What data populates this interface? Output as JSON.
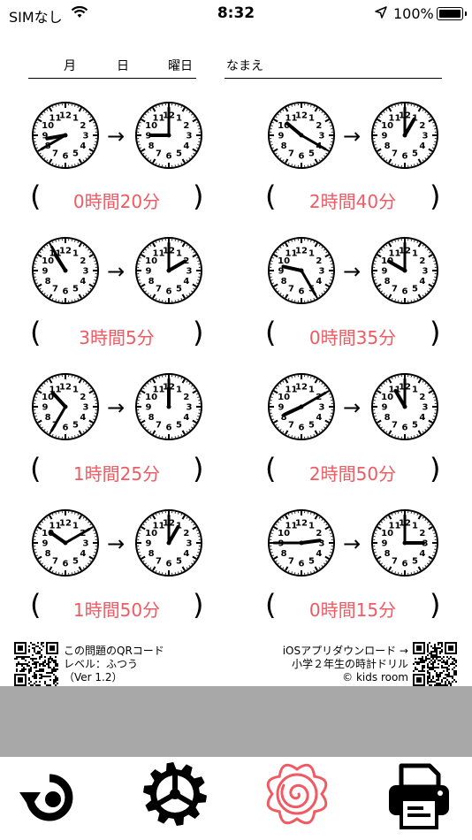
{
  "status_bar": {
    "carrier": "SIMなし",
    "time": "8:32",
    "battery": "100%",
    "battery_level": 1.0
  },
  "worksheet": {
    "date_labels": [
      "月",
      "日",
      "曜日"
    ],
    "name_label": "なまえ",
    "problems": [
      {
        "answer": "0時間20分",
        "start": {
          "hour": 8,
          "minute": 40
        },
        "end": {
          "hour": 9,
          "minute": 0
        }
      },
      {
        "answer": "2時間40分",
        "start": {
          "hour": 10,
          "minute": 20
        },
        "end": {
          "hour": 1,
          "minute": 0
        }
      },
      {
        "answer": "3時間5分",
        "start": {
          "hour": 10,
          "minute": 55
        },
        "end": {
          "hour": 2,
          "minute": 0
        }
      },
      {
        "answer": "0時間35分",
        "start": {
          "hour": 9,
          "minute": 25
        },
        "end": {
          "hour": 10,
          "minute": 0
        }
      },
      {
        "answer": "1時間25分",
        "start": {
          "hour": 10,
          "minute": 35
        },
        "end": {
          "hour": 12,
          "minute": 0
        }
      },
      {
        "answer": "2時間50分",
        "start": {
          "hour": 8,
          "minute": 10
        },
        "end": {
          "hour": 11,
          "minute": 0
        }
      },
      {
        "answer": "1時間50分",
        "start": {
          "hour": 10,
          "minute": 10
        },
        "end": {
          "hour": 1,
          "minute": 0
        }
      },
      {
        "answer": "0時間15分",
        "start": {
          "hour": 2,
          "minute": 45
        },
        "end": {
          "hour": 3,
          "minute": 0
        }
      }
    ],
    "arrow": "→",
    "paren_open": "(",
    "paren_close": ")"
  },
  "footer": {
    "left_line1": "この問題のQRコード",
    "left_line2": "レベル：ふつう",
    "left_line3": "（Ver 1.2）",
    "right_line1": "iOSアプリダウンロード →",
    "right_line2": "小学２年生の時計ドリル",
    "right_line3": "© kids room"
  },
  "toolbar": {
    "icons": [
      "undo-icon",
      "gear-icon",
      "flower-icon",
      "printer-icon"
    ],
    "flower_color": "#ef5a63"
  }
}
